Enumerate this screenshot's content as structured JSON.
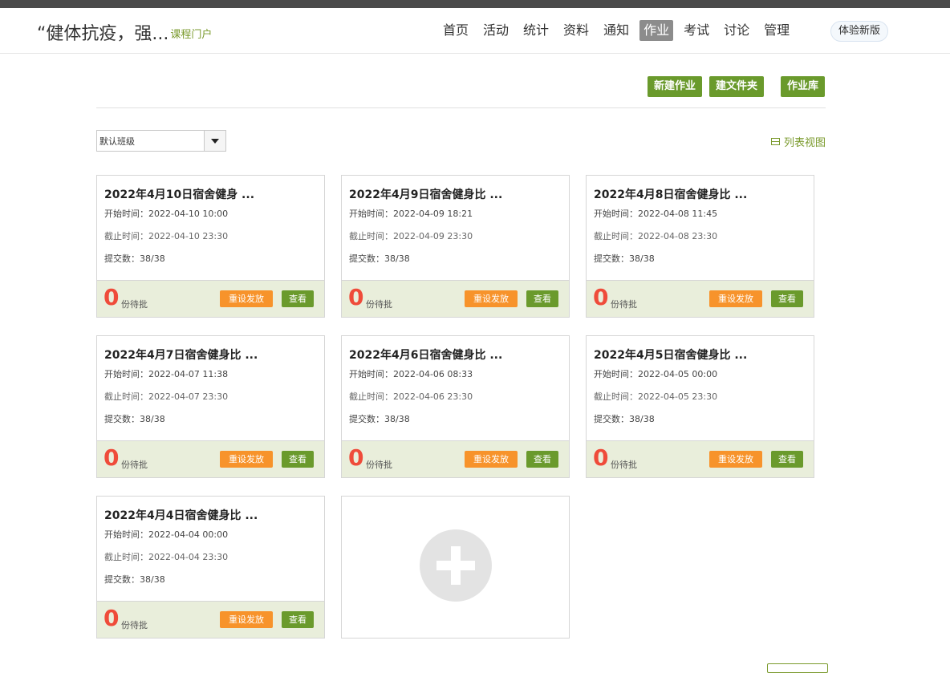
{
  "header": {
    "course_title": "“健体抗疫，强...",
    "portal_link": "课程门户",
    "nav": [
      {
        "label": "首页",
        "active": false
      },
      {
        "label": "活动",
        "active": false
      },
      {
        "label": "统计",
        "active": false
      },
      {
        "label": "资料",
        "active": false
      },
      {
        "label": "通知",
        "active": false
      },
      {
        "label": "作业",
        "active": true
      },
      {
        "label": "考试",
        "active": false
      },
      {
        "label": "讨论",
        "active": false
      },
      {
        "label": "管理",
        "active": false
      }
    ],
    "new_version": "体验新版"
  },
  "toolbar": {
    "new_assignment": "新建作业",
    "new_folder": "建文件夹",
    "assignment_library": "作业库"
  },
  "filter": {
    "class_selected": "默认班级",
    "list_view": "列表视图"
  },
  "card_labels": {
    "start_prefix": "开始时间：",
    "end_prefix": "截止时间：",
    "submit_prefix": "提交数：",
    "pending_suffix": "份待批",
    "reset_button": "重设发放",
    "view_button": "查看"
  },
  "assignments": [
    {
      "title": "2022年4月10日宿舍健身 ...",
      "start": "2022-04-10 10:00",
      "end": "2022-04-10 23:30",
      "submitted": "38/38",
      "pending": "0"
    },
    {
      "title": "2022年4月9日宿舍健身比 ...",
      "start": "2022-04-09 18:21",
      "end": "2022-04-09 23:30",
      "submitted": "38/38",
      "pending": "0"
    },
    {
      "title": "2022年4月8日宿舍健身比 ...",
      "start": "2022-04-08 11:45",
      "end": "2022-04-08 23:30",
      "submitted": "38/38",
      "pending": "0"
    },
    {
      "title": "2022年4月7日宿舍健身比 ...",
      "start": "2022-04-07 11:38",
      "end": "2022-04-07 23:30",
      "submitted": "38/38",
      "pending": "0"
    },
    {
      "title": "2022年4月6日宿舍健身比 ...",
      "start": "2022-04-06 08:33",
      "end": "2022-04-06 23:30",
      "submitted": "38/38",
      "pending": "0"
    },
    {
      "title": "2022年4月5日宿舍健身比 ...",
      "start": "2022-04-05 00:00",
      "end": "2022-04-05 23:30",
      "submitted": "38/38",
      "pending": "0"
    },
    {
      "title": "2022年4月4日宿舍健身比 ...",
      "start": "2022-04-04 00:00",
      "end": "2022-04-04 23:30",
      "submitted": "38/38",
      "pending": "0"
    }
  ],
  "colors": {
    "accent_green": "#6a9a2c",
    "reset_orange": "#f7932b",
    "pending_red": "#ef4b3a",
    "footer_bg": "#e9eedb"
  },
  "icons": {
    "add_card": "plus-circle-icon",
    "list_view": "list-view-icon",
    "dropdown": "chevron-down-icon"
  }
}
